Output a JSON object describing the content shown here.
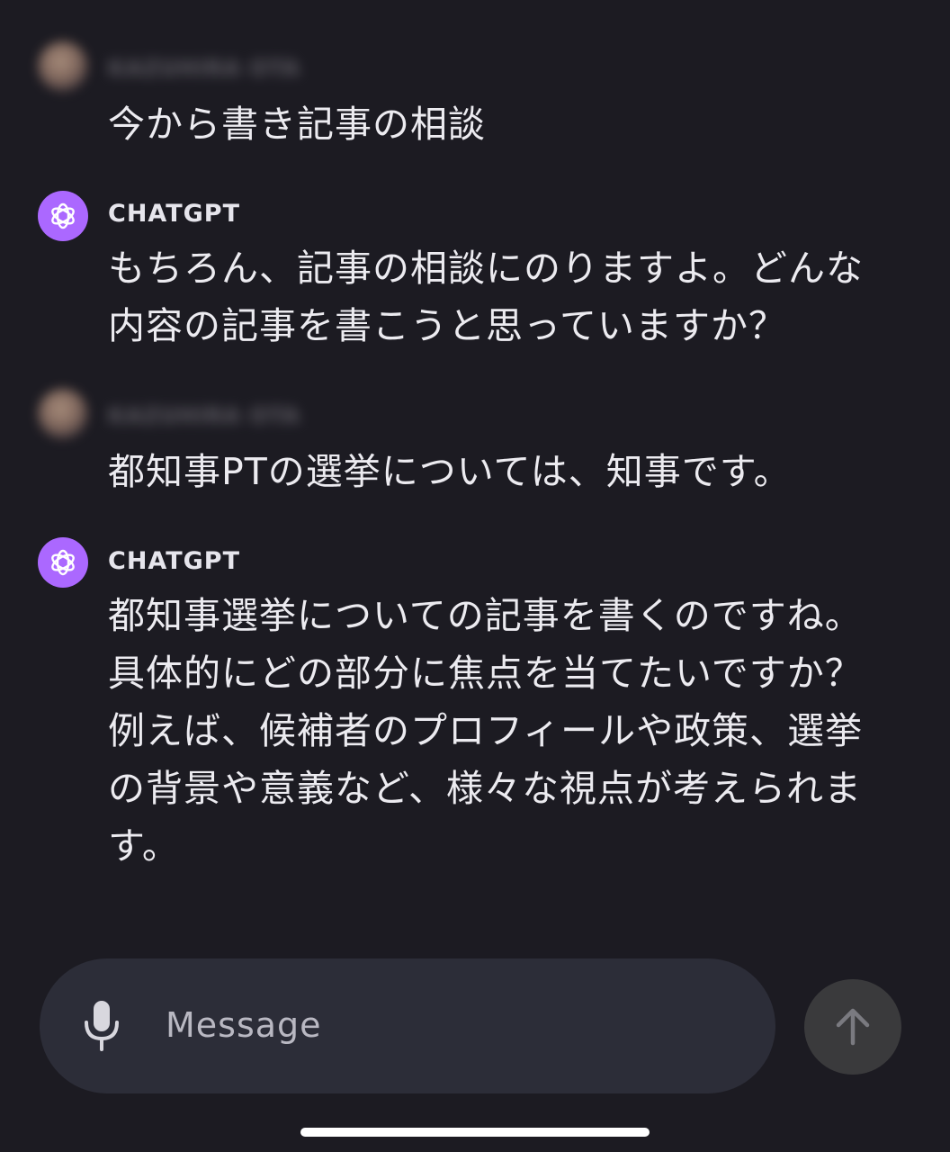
{
  "messages": [
    {
      "role": "user",
      "sender": "KAZUHIRA OTA",
      "text": "今から書き記事の相談"
    },
    {
      "role": "assistant",
      "sender": "CHATGPT",
      "text": "もちろん、記事の相談にのりますよ。どんな\n内容の記事を書こうと思っていますか？"
    },
    {
      "role": "user",
      "sender": "KAZUHIRA OTA",
      "text": "都知事PTの選挙については、知事です。"
    },
    {
      "role": "assistant",
      "sender": "CHATGPT",
      "text": "都知事選挙についての記事を書くのですね。\n具体的にどの部分に焦点を当てたいですか？\n例えば、候補者のプロフィールや政策、選挙\nの背景や意義など、様々な視点が考えられま\nす。"
    }
  ],
  "composer": {
    "placeholder": "Message"
  },
  "icons": {
    "mic": "microphone-icon",
    "send": "arrow-up-icon",
    "assistant_avatar": "openai-logo-icon"
  },
  "colors": {
    "background": "#1c1b22",
    "assistant_avatar": "#ab68ff",
    "composer": "#2c2d38",
    "send_button": "#3a3a3c"
  }
}
